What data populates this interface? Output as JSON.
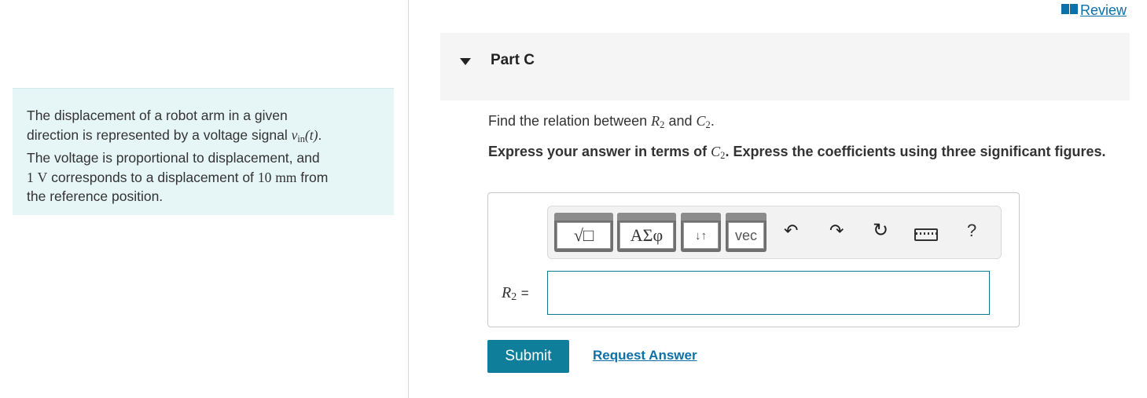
{
  "intro": {
    "line1": "The displacement of a robot arm in a given",
    "line2_pre": "direction is represented by a voltage signal",
    "line2_var": "v",
    "line2_sub": "in",
    "line2_arg": "(t)",
    "line2_end": ".",
    "line3": "The voltage is proportional to displacement, and",
    "line4_num": "1",
    "line4_unit": "V",
    "line4_mid": "corresponds to a displacement of",
    "line4_num2": "10",
    "line4_unit2": "mm",
    "line4_end": "from",
    "line5": "the reference position."
  },
  "review": {
    "label": "Review"
  },
  "part": {
    "title": "Part C"
  },
  "question": {
    "pre": "Find the relation between",
    "var1": "R",
    "var1_sub": "2",
    "and": "and",
    "var2": "C",
    "var2_sub": "2",
    "end": "."
  },
  "instructions": {
    "pre": "Express your answer in terms of",
    "var": "C",
    "var_sub": "2",
    "post": ". Express the coefficients using three significant figures."
  },
  "toolbar": {
    "templates_label": "√□",
    "greek_label": "ΑΣφ",
    "arrows_label": "↓↑",
    "vec_label": "vec",
    "undo_glyph": "↶",
    "redo_glyph": "↷",
    "reset_glyph": "↻",
    "help_glyph": "?"
  },
  "answer": {
    "var": "R",
    "var_sub": "2",
    "equals": "=",
    "value": ""
  },
  "actions": {
    "submit_label": "Submit",
    "request_label": "Request Answer"
  },
  "colors": {
    "accent": "#0f7e9b",
    "link": "#0c71a8",
    "intro_bg": "#e6f5f6",
    "header_bg": "#f5f5f5"
  }
}
